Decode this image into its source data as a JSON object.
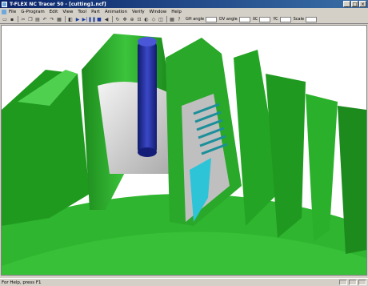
{
  "window": {
    "title": "T-FLEX NC Tracer 50 - [cutting1.ncf]",
    "buttons": [
      "_",
      "□",
      "×"
    ]
  },
  "menu": [
    "File",
    "G-Program",
    "Edit",
    "View",
    "Tool",
    "Part",
    "Animation",
    "Verify",
    "Window",
    "Help"
  ],
  "toolbar": {
    "fields": [
      {
        "label": "GH angle"
      },
      {
        "label": "DV angle"
      },
      {
        "label": "XC"
      },
      {
        "label": "YC"
      },
      {
        "label": "Scale"
      }
    ]
  },
  "status": {
    "text": "For Help, press F1"
  },
  "colors": {
    "part_green": "#2fb52f",
    "part_dark_green": "#1c8a1c",
    "tool_blue": "#202a8c",
    "machined_gray": "#d8d8d8",
    "cyan": "#2ec4d8"
  }
}
